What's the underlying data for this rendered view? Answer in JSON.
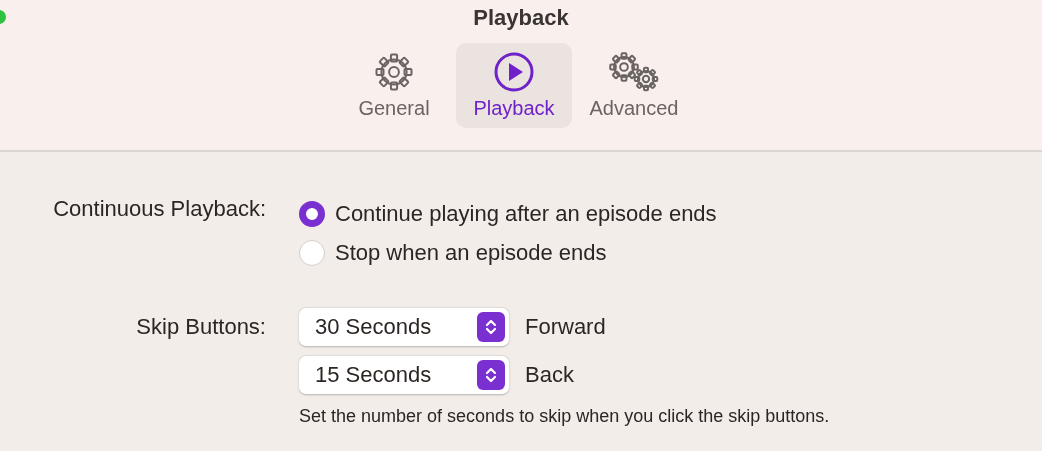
{
  "window": {
    "title": "Playback"
  },
  "tabs": [
    {
      "label": "General",
      "kind": "gear",
      "selected": false
    },
    {
      "label": "Playback",
      "kind": "play",
      "selected": true
    },
    {
      "label": "Advanced",
      "kind": "gears",
      "selected": false
    }
  ],
  "continuous_playback": {
    "label": "Continuous Playback:",
    "options": [
      {
        "label": "Continue playing after an episode ends",
        "selected": true
      },
      {
        "label": "Stop when an episode ends",
        "selected": false
      }
    ]
  },
  "skip_buttons": {
    "label": "Skip Buttons:",
    "popups": [
      {
        "value": "30 Seconds",
        "caption": "Forward"
      },
      {
        "value": "15 Seconds",
        "caption": "Back"
      }
    ],
    "help": "Set the number of seconds to skip when you click the skip buttons."
  }
}
